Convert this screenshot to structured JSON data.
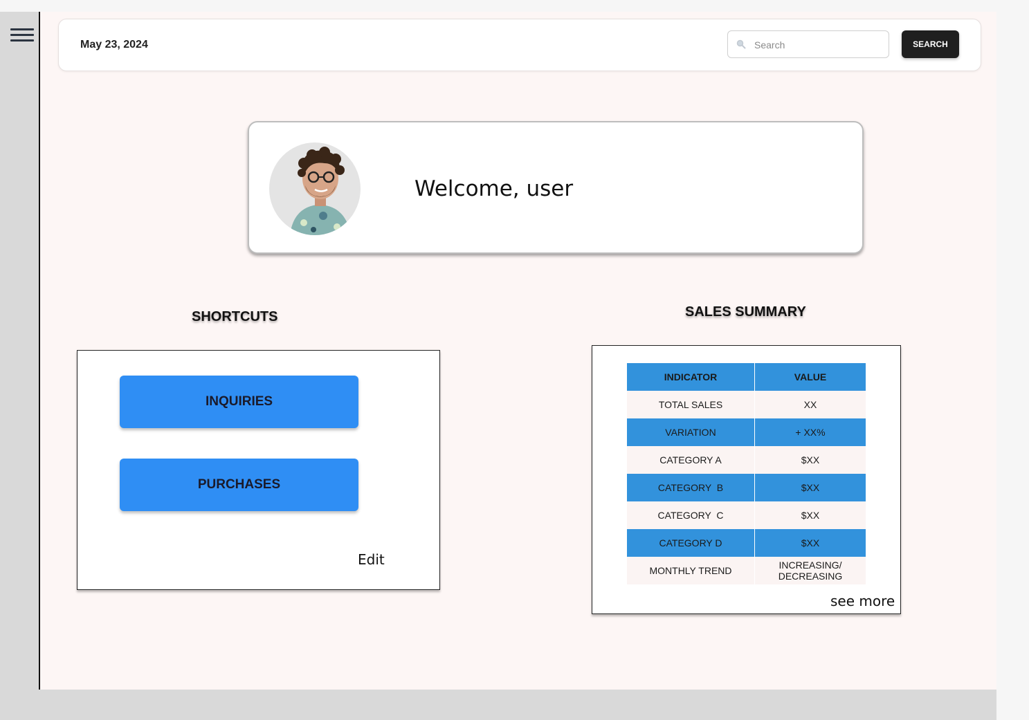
{
  "header": {
    "date": "May 23, 2024",
    "search_placeholder": "Search",
    "search_button": "SEARCH"
  },
  "welcome": {
    "text": "Welcome, user"
  },
  "shortcuts": {
    "title": "SHORTCUTS",
    "buttons": [
      "INQUIRIES",
      "PURCHASES"
    ],
    "edit_label": "Edit"
  },
  "sales_summary": {
    "title": "SALES SUMMARY",
    "headers": [
      "INDICATOR",
      "VALUE"
    ],
    "rows": [
      {
        "indicator": "TOTAL SALES",
        "value": "XX"
      },
      {
        "indicator": "VARIATION",
        "value": "+ XX%"
      },
      {
        "indicator": "CATEGORY A",
        "value": "$XX"
      },
      {
        "indicator": "CATEGORY  B",
        "value": "$XX"
      },
      {
        "indicator": "CATEGORY  C",
        "value": "$XX"
      },
      {
        "indicator": "CATEGORY D",
        "value": "$XX"
      },
      {
        "indicator": "MONTHLY TREND",
        "value": "INCREASING/ DECREASING"
      }
    ],
    "see_more": "see more"
  },
  "colors": {
    "accent_blue": "#2f8ef4",
    "table_blue": "#3292dc",
    "page_background": "#fdf6f5",
    "sidebar_gray": "#d9d9d9",
    "button_dark": "#1f1f1f"
  }
}
